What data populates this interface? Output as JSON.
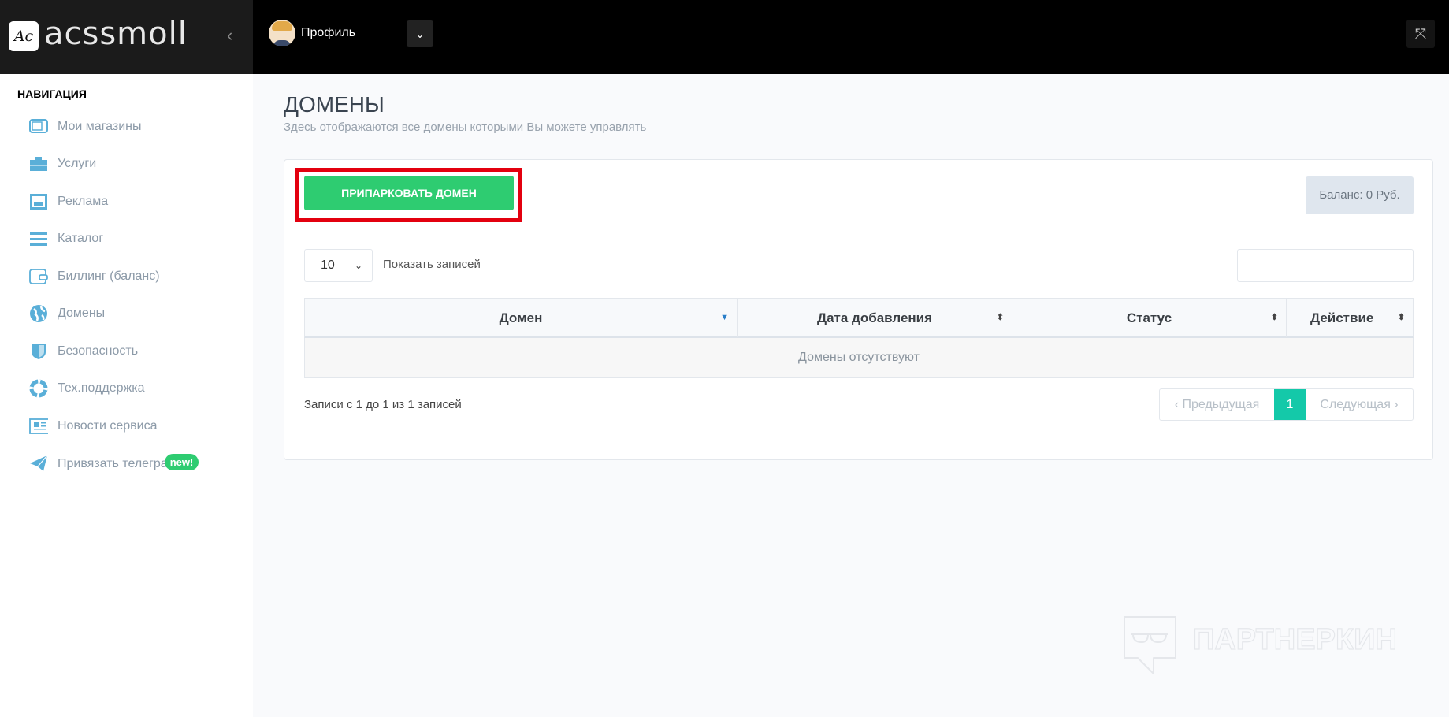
{
  "header": {
    "logo_mark": "Ac",
    "logo_text": "acssmoll",
    "profile_label": "Профиль"
  },
  "sidebar": {
    "title": "НАВИГАЦИЯ",
    "items": [
      {
        "label": "Мои магазины",
        "icon": "tv-icon"
      },
      {
        "label": "Услуги",
        "icon": "briefcase-icon"
      },
      {
        "label": "Реклама",
        "icon": "ad-panel-icon"
      },
      {
        "label": "Каталог",
        "icon": "list-icon"
      },
      {
        "label": "Биллинг (баланс)",
        "icon": "wallet-icon"
      },
      {
        "label": "Домены",
        "icon": "globe-icon"
      },
      {
        "label": "Безопасность",
        "icon": "shield-icon"
      },
      {
        "label": "Тех.поддержка",
        "icon": "lifebuoy-icon"
      },
      {
        "label": "Новости сервиса",
        "icon": "newspaper-icon"
      },
      {
        "label": "Привязать телегра",
        "icon": "telegram-icon",
        "badge": "new!"
      }
    ]
  },
  "page": {
    "title": "ДОМЕНЫ",
    "subtitle": "Здесь отображаются все домены которыми Вы можете управлять"
  },
  "card": {
    "park_button": "ПРИПАРКОВАТЬ ДОМЕН",
    "balance": "Баланс: 0 Руб.",
    "page_length": "10",
    "page_length_label": "Показать записей",
    "search_value": "",
    "columns": [
      "Домен",
      "Дата добавления",
      "Статус",
      "Действие"
    ],
    "empty_text": "Домены отсутствуют",
    "info": "Записи с 1 до 1 из 1 записей",
    "pagination": {
      "prev": "Предыдущая",
      "current": "1",
      "next": "Следующая"
    }
  },
  "watermark": "ПАРТНЕРКИН",
  "colors": {
    "accent_green": "#2ecc71",
    "page_active": "#14c9a9",
    "highlight": "#e3000f",
    "icon_blue": "#5aafd8"
  }
}
